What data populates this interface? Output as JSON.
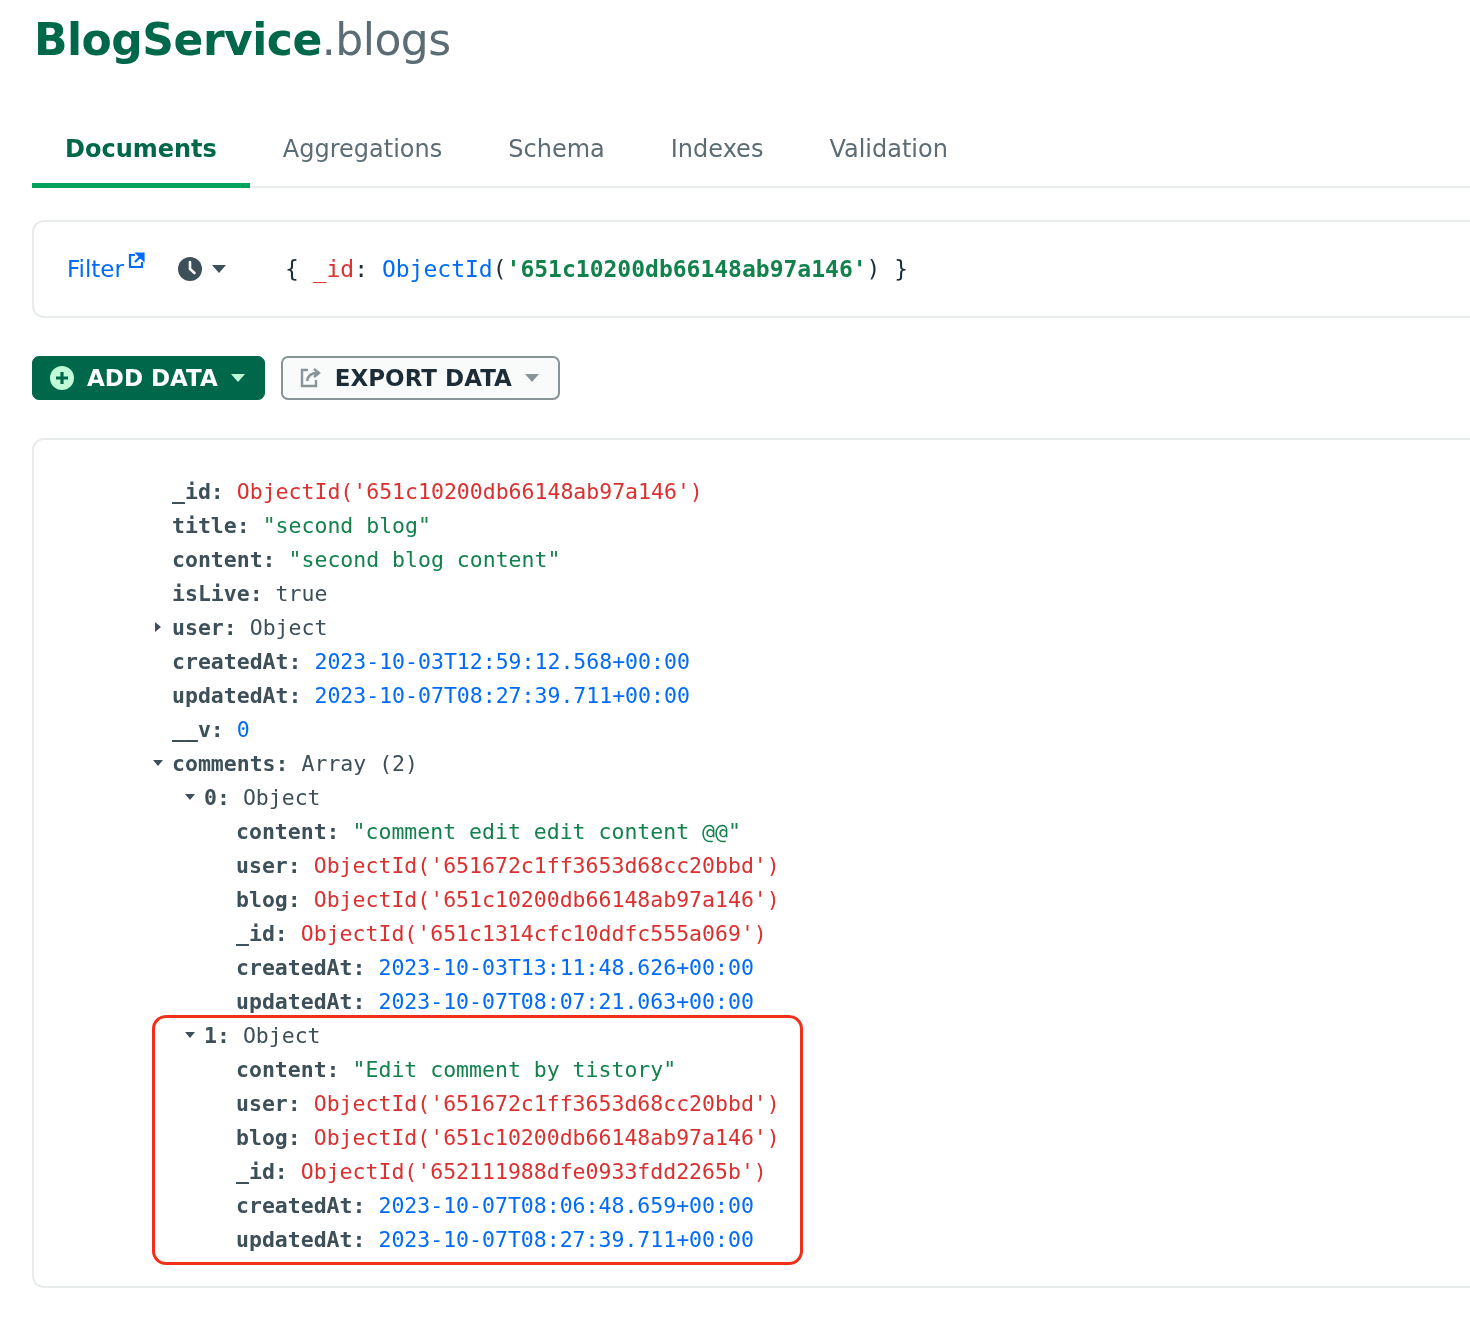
{
  "header": {
    "database": "BlogService",
    "collection": ".blogs"
  },
  "tabs": [
    {
      "label": "Documents",
      "selected": true
    },
    {
      "label": "Aggregations",
      "selected": false
    },
    {
      "label": "Schema",
      "selected": false
    },
    {
      "label": "Indexes",
      "selected": false
    },
    {
      "label": "Validation",
      "selected": false
    }
  ],
  "filter": {
    "label": "Filter",
    "query": [
      {
        "text": "{ ",
        "kind": "punct"
      },
      {
        "text": "_id",
        "kind": "key"
      },
      {
        "text": ": ",
        "kind": "punct"
      },
      {
        "text": "ObjectId",
        "kind": "function"
      },
      {
        "text": "(",
        "kind": "punct"
      },
      {
        "text": "'651c10200db66148ab97a146'",
        "kind": "string"
      },
      {
        "text": ") }",
        "kind": "punct"
      }
    ]
  },
  "buttons": [
    {
      "label": "ADD DATA",
      "kind": "primary"
    },
    {
      "label": "EXPORT DATA",
      "kind": "secondary"
    }
  ],
  "document": {
    "fields": [
      {
        "key": "_id:",
        "value": "ObjectId('651c10200db66148ab97a146')",
        "kind": "objectid"
      },
      {
        "key": "title:",
        "value": "\"second blog\"",
        "kind": "string"
      },
      {
        "key": "content:",
        "value": "\"second blog content\"",
        "kind": "string"
      },
      {
        "key": "isLive:",
        "value": "true",
        "kind": "bool"
      },
      {
        "key": "user:",
        "value": "Object",
        "kind": "object",
        "expanded": false
      },
      {
        "key": "createdAt:",
        "value": "2023-10-03T12:59:12.568+00:00",
        "kind": "date"
      },
      {
        "key": "updatedAt:",
        "value": "2023-10-07T08:27:39.711+00:00",
        "kind": "date"
      },
      {
        "key": "__v:",
        "value": "0",
        "kind": "number"
      },
      {
        "key": "comments:",
        "value": "Array (2)",
        "kind": "array",
        "expanded": true,
        "children": [
          {
            "key": "0:",
            "value": "Object",
            "kind": "object",
            "expanded": true,
            "highlighted": false,
            "children": [
              {
                "key": "content:",
                "value": "\"comment edit edit content @@\"",
                "kind": "string"
              },
              {
                "key": "user:",
                "value": "ObjectId('651672c1ff3653d68cc20bbd')",
                "kind": "objectid"
              },
              {
                "key": "blog:",
                "value": "ObjectId('651c10200db66148ab97a146')",
                "kind": "objectid"
              },
              {
                "key": "_id:",
                "value": "ObjectId('651c1314cfc10ddfc555a069')",
                "kind": "objectid"
              },
              {
                "key": "createdAt:",
                "value": "2023-10-03T13:11:48.626+00:00",
                "kind": "date"
              },
              {
                "key": "updatedAt:",
                "value": "2023-10-07T08:07:21.063+00:00",
                "kind": "date"
              }
            ]
          },
          {
            "key": "1:",
            "value": "Object",
            "kind": "object",
            "expanded": true,
            "highlighted": true,
            "children": [
              {
                "key": "content:",
                "value": "\"Edit comment by tistory\"",
                "kind": "string"
              },
              {
                "key": "user:",
                "value": "ObjectId('651672c1ff3653d68cc20bbd')",
                "kind": "objectid"
              },
              {
                "key": "blog:",
                "value": "ObjectId('651c10200db66148ab97a146')",
                "kind": "objectid"
              },
              {
                "key": "_id:",
                "value": "ObjectId('652111988dfe0933fdd2265b')",
                "kind": "objectid"
              },
              {
                "key": "createdAt:",
                "value": "2023-10-07T08:06:48.659+00:00",
                "kind": "date"
              },
              {
                "key": "updatedAt:",
                "value": "2023-10-07T08:27:39.711+00:00",
                "kind": "date"
              }
            ]
          }
        ]
      }
    ]
  }
}
